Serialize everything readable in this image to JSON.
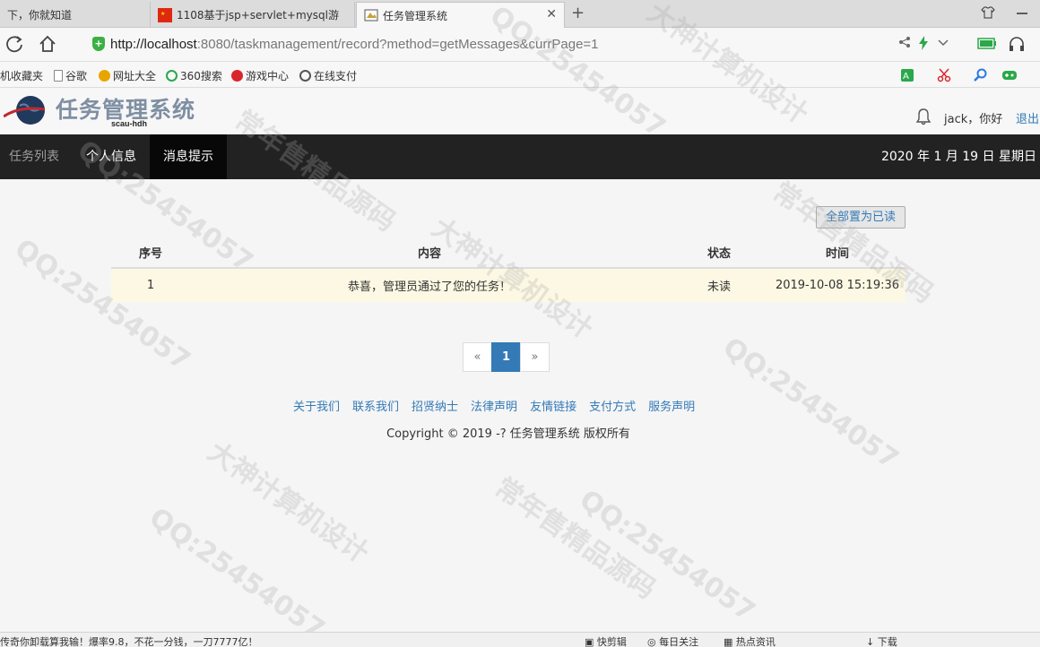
{
  "browser": {
    "tabs": [
      {
        "label": "下，你就知道",
        "active": false
      },
      {
        "label": "1108基于jsp+servlet+mysql游",
        "active": false
      },
      {
        "label": "任务管理系统",
        "active": true
      }
    ],
    "tab_new_glyph": "+",
    "tab_close_glyph": "✕",
    "url_host": "http://localhost",
    "url_rest": ":8080/taskmanagement/record?method=getMessages&currPage=1",
    "bookmarks": [
      {
        "label": "机收藏夹",
        "icon": "folder-icon",
        "color": "#f0b400"
      },
      {
        "label": "谷歌",
        "icon": "page-icon",
        "color": "#888888"
      },
      {
        "label": "网址大全",
        "icon": "globe-icon",
        "color": "#e8a500"
      },
      {
        "label": "360搜索",
        "icon": "search-icon",
        "color": "#2aa84a"
      },
      {
        "label": "游戏中心",
        "icon": "game-icon",
        "color": "#d9262b"
      },
      {
        "label": "在线支付",
        "icon": "pay-icon",
        "color": "#555555"
      }
    ]
  },
  "site": {
    "logo_text": "任务管理系统",
    "logo_sub": "scau-hdh",
    "user_greeting": "jack，你好",
    "logout_label": "退出"
  },
  "nav": {
    "items": [
      {
        "label": "任务列表",
        "state": "dim"
      },
      {
        "label": "个人信息",
        "state": "normal"
      },
      {
        "label": "消息提示",
        "state": "active"
      }
    ],
    "date": "2020 年 1 月 19 日 星期日"
  },
  "main": {
    "mark_all_label": "全部置为已读",
    "table": {
      "headers": [
        "序号",
        "内容",
        "状态",
        "时间"
      ],
      "rows": [
        {
          "index": "1",
          "content": "恭喜，管理员通过了您的任务！",
          "status": "未读",
          "time": "2019-10-08 15:19:36"
        }
      ]
    },
    "pagination": {
      "prev": "«",
      "current": "1",
      "next": "»"
    }
  },
  "footer": {
    "links": [
      "关于我们",
      "联系我们",
      "招贤纳士",
      "法律声明",
      "友情链接",
      "支付方式",
      "服务声明"
    ],
    "copyright": "Copyright © 2019 -? 任务管理系统 版权所有"
  },
  "statusbar": {
    "ticker": "传奇你卸载算我输！爆率9.8，不花一分钱，一刀7777亿！",
    "items": [
      "快剪辑",
      "每日关注",
      "热点资讯",
      "下载"
    ]
  },
  "watermarks": [
    "QQ:25454057",
    "大神计算机设计",
    "常年售精品源码",
    "QQ:25454057",
    "大神计算机设计",
    "常年售精品源码",
    "QQ:25454057",
    "QQ:25454057",
    "大神计算机设计",
    "常年售精品源码",
    "QQ:25454057",
    "QQ:25454057"
  ],
  "colors": {
    "link": "#337ab7",
    "navbar": "#222222",
    "nav_active": "#080808",
    "unread_row": "#fcf8e3",
    "unread_text": "#3c763d"
  }
}
